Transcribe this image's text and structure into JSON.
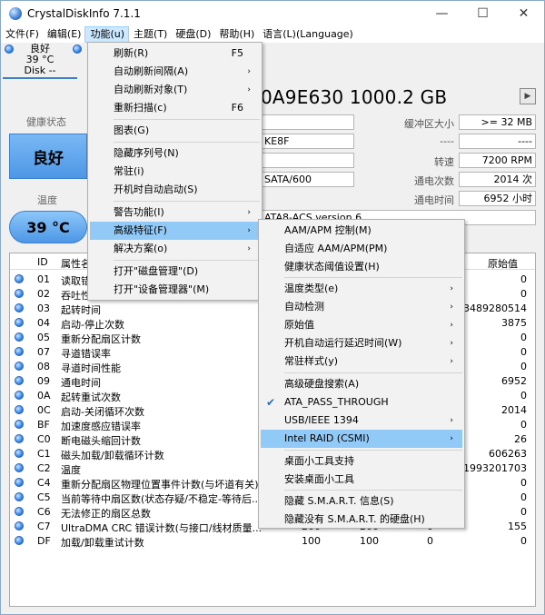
{
  "title": "CrystalDiskInfo 7.1.1",
  "window_buttons": {
    "minimize": "—",
    "maximize": "☐",
    "close": "✕"
  },
  "menubar": [
    "文件(F)",
    "编辑(E)",
    "功能(u)",
    "主题(T)",
    "硬盘(D)",
    "帮助(H)",
    "语言(L)(Language)"
  ],
  "disk_tab": {
    "status": "良好",
    "temp": "39 °C",
    "name": "Disk --"
  },
  "model": "0A9E630 1000.2 GB",
  "health": {
    "label": "健康状态",
    "value": "良好"
  },
  "temperature": {
    "label": "温度",
    "value": "39 °C"
  },
  "info_fields": {
    "f1": "",
    "f2": "KE8F",
    "f3": "",
    "f4": "SATA/600",
    "f5": "ATA8-ACS version 6"
  },
  "right_fields": [
    {
      "label": "缓冲区大小",
      "value": ">= 32 MB"
    },
    {
      "label": "----",
      "value": "----"
    },
    {
      "label": "转速",
      "value": "7200 RPM"
    },
    {
      "label": "通电次数",
      "value": "2014 次"
    },
    {
      "label": "通电时间",
      "value": "6952 小时"
    }
  ],
  "table": {
    "headers": {
      "id": "ID",
      "name": "属性名",
      "raw": "原始值"
    },
    "rows": [
      {
        "id": "01",
        "name": "读取错",
        "v1": "",
        "v2": "",
        "v3": "",
        "raw": "0"
      },
      {
        "id": "02",
        "name": "吞吐性",
        "v1": "",
        "v2": "",
        "v3": "",
        "raw": "0"
      },
      {
        "id": "03",
        "name": "起转时间",
        "v1": "",
        "v2": "",
        "v3": "",
        "raw": "3489280514"
      },
      {
        "id": "04",
        "name": "启动-停止次数",
        "v1": "",
        "v2": "",
        "v3": "",
        "raw": "3875"
      },
      {
        "id": "05",
        "name": "重新分配扇区计数",
        "v1": "",
        "v2": "",
        "v3": "",
        "raw": "0"
      },
      {
        "id": "07",
        "name": "寻道错误率",
        "v1": "",
        "v2": "",
        "v3": "",
        "raw": "0"
      },
      {
        "id": "08",
        "name": "寻道时间性能",
        "v1": "",
        "v2": "",
        "v3": "",
        "raw": "0"
      },
      {
        "id": "09",
        "name": "通电时间",
        "v1": "",
        "v2": "",
        "v3": "",
        "raw": "6952"
      },
      {
        "id": "0A",
        "name": "起转重试次数",
        "v1": "",
        "v2": "",
        "v3": "",
        "raw": "0"
      },
      {
        "id": "0C",
        "name": "启动-关闭循环次数",
        "v1": "",
        "v2": "",
        "v3": "",
        "raw": "2014"
      },
      {
        "id": "BF",
        "name": "加速度感应错误率",
        "v1": "",
        "v2": "",
        "v3": "",
        "raw": "0"
      },
      {
        "id": "C0",
        "name": "断电磁头缩回计数",
        "v1": "",
        "v2": "",
        "v3": "",
        "raw": "26"
      },
      {
        "id": "C1",
        "name": "磁头加载/卸载循环计数",
        "v1": "",
        "v2": "",
        "v3": "",
        "raw": "606263"
      },
      {
        "id": "C2",
        "name": "温度",
        "v1": "",
        "v2": "",
        "v3": "",
        "raw": "1993201703"
      },
      {
        "id": "C4",
        "name": "重新分配扇区物理位置事件计数(与坏道有关)",
        "v1": "",
        "v2": "",
        "v3": "",
        "raw": "0"
      },
      {
        "id": "C5",
        "name": "当前等待中扇区数(状态存疑/不稳定-等待后...",
        "v1": "",
        "v2": "",
        "v3": "",
        "raw": "0"
      },
      {
        "id": "C6",
        "name": "无法修正的扇区总数",
        "v1": "",
        "v2": "",
        "v3": "",
        "raw": "0"
      },
      {
        "id": "C7",
        "name": "UltraDMA CRC 错误计数(与接口/线材质量...",
        "v1": "200",
        "v2": "200",
        "v3": "0",
        "raw": "155"
      },
      {
        "id": "DF",
        "name": "加载/卸载重试计数",
        "v1": "100",
        "v2": "100",
        "v3": "0",
        "raw": "0"
      }
    ]
  },
  "function_menu": [
    {
      "label": "刷新(R)",
      "shortcut": "F5",
      "arrow": ""
    },
    {
      "label": "自动刷新间隔(A)",
      "shortcut": "",
      "arrow": "›"
    },
    {
      "label": "自动刷新对象(T)",
      "shortcut": "",
      "arrow": "›"
    },
    {
      "label": "重新扫描(c)",
      "shortcut": "F6",
      "arrow": ""
    },
    {
      "label": "图表(G)",
      "shortcut": "",
      "arrow": ""
    },
    {
      "label": "隐藏序列号(N)",
      "shortcut": "",
      "arrow": ""
    },
    {
      "label": "常驻(i)",
      "shortcut": "",
      "arrow": ""
    },
    {
      "label": "开机时自动启动(S)",
      "shortcut": "",
      "arrow": ""
    },
    {
      "label": "警告功能(I)",
      "shortcut": "",
      "arrow": "›"
    },
    {
      "label": "高级特征(F)",
      "shortcut": "",
      "arrow": "›"
    },
    {
      "label": "解决方案(o)",
      "shortcut": "",
      "arrow": "›"
    },
    {
      "label": "打开\"磁盘管理\"(D)",
      "shortcut": "",
      "arrow": ""
    },
    {
      "label": "打开\"设备管理器\"(M)",
      "shortcut": "",
      "arrow": ""
    }
  ],
  "advanced_menu": [
    {
      "label": "AAM/APM 控制(M)",
      "arrow": "",
      "checked": ""
    },
    {
      "label": "自适应 AAM/APM(PM)",
      "arrow": "",
      "checked": ""
    },
    {
      "label": "健康状态阈值设置(H)",
      "arrow": "",
      "checked": ""
    },
    {
      "label": "温度类型(e)",
      "arrow": "›",
      "checked": ""
    },
    {
      "label": "自动检测",
      "arrow": "›",
      "checked": ""
    },
    {
      "label": "原始值",
      "arrow": "›",
      "checked": ""
    },
    {
      "label": "开机自动运行延迟时间(W)",
      "arrow": "›",
      "checked": ""
    },
    {
      "label": "常驻样式(y)",
      "arrow": "›",
      "checked": ""
    },
    {
      "label": "高级硬盘搜索(A)",
      "arrow": "",
      "checked": ""
    },
    {
      "label": "ATA_PASS_THROUGH",
      "arrow": "",
      "checked": "✔"
    },
    {
      "label": "USB/IEEE 1394",
      "arrow": "›",
      "checked": ""
    },
    {
      "label": "Intel RAID (CSMI)",
      "arrow": "›",
      "checked": ""
    },
    {
      "label": "桌面小工具支持",
      "arrow": "",
      "checked": ""
    },
    {
      "label": "安装桌面小工具",
      "arrow": "",
      "checked": ""
    },
    {
      "label": "隐藏 S.M.A.R.T. 信息(S)",
      "arrow": "",
      "checked": ""
    },
    {
      "label": "隐藏没有 S.M.A.R.T. 的硬盘(H)",
      "arrow": "",
      "checked": ""
    }
  ]
}
